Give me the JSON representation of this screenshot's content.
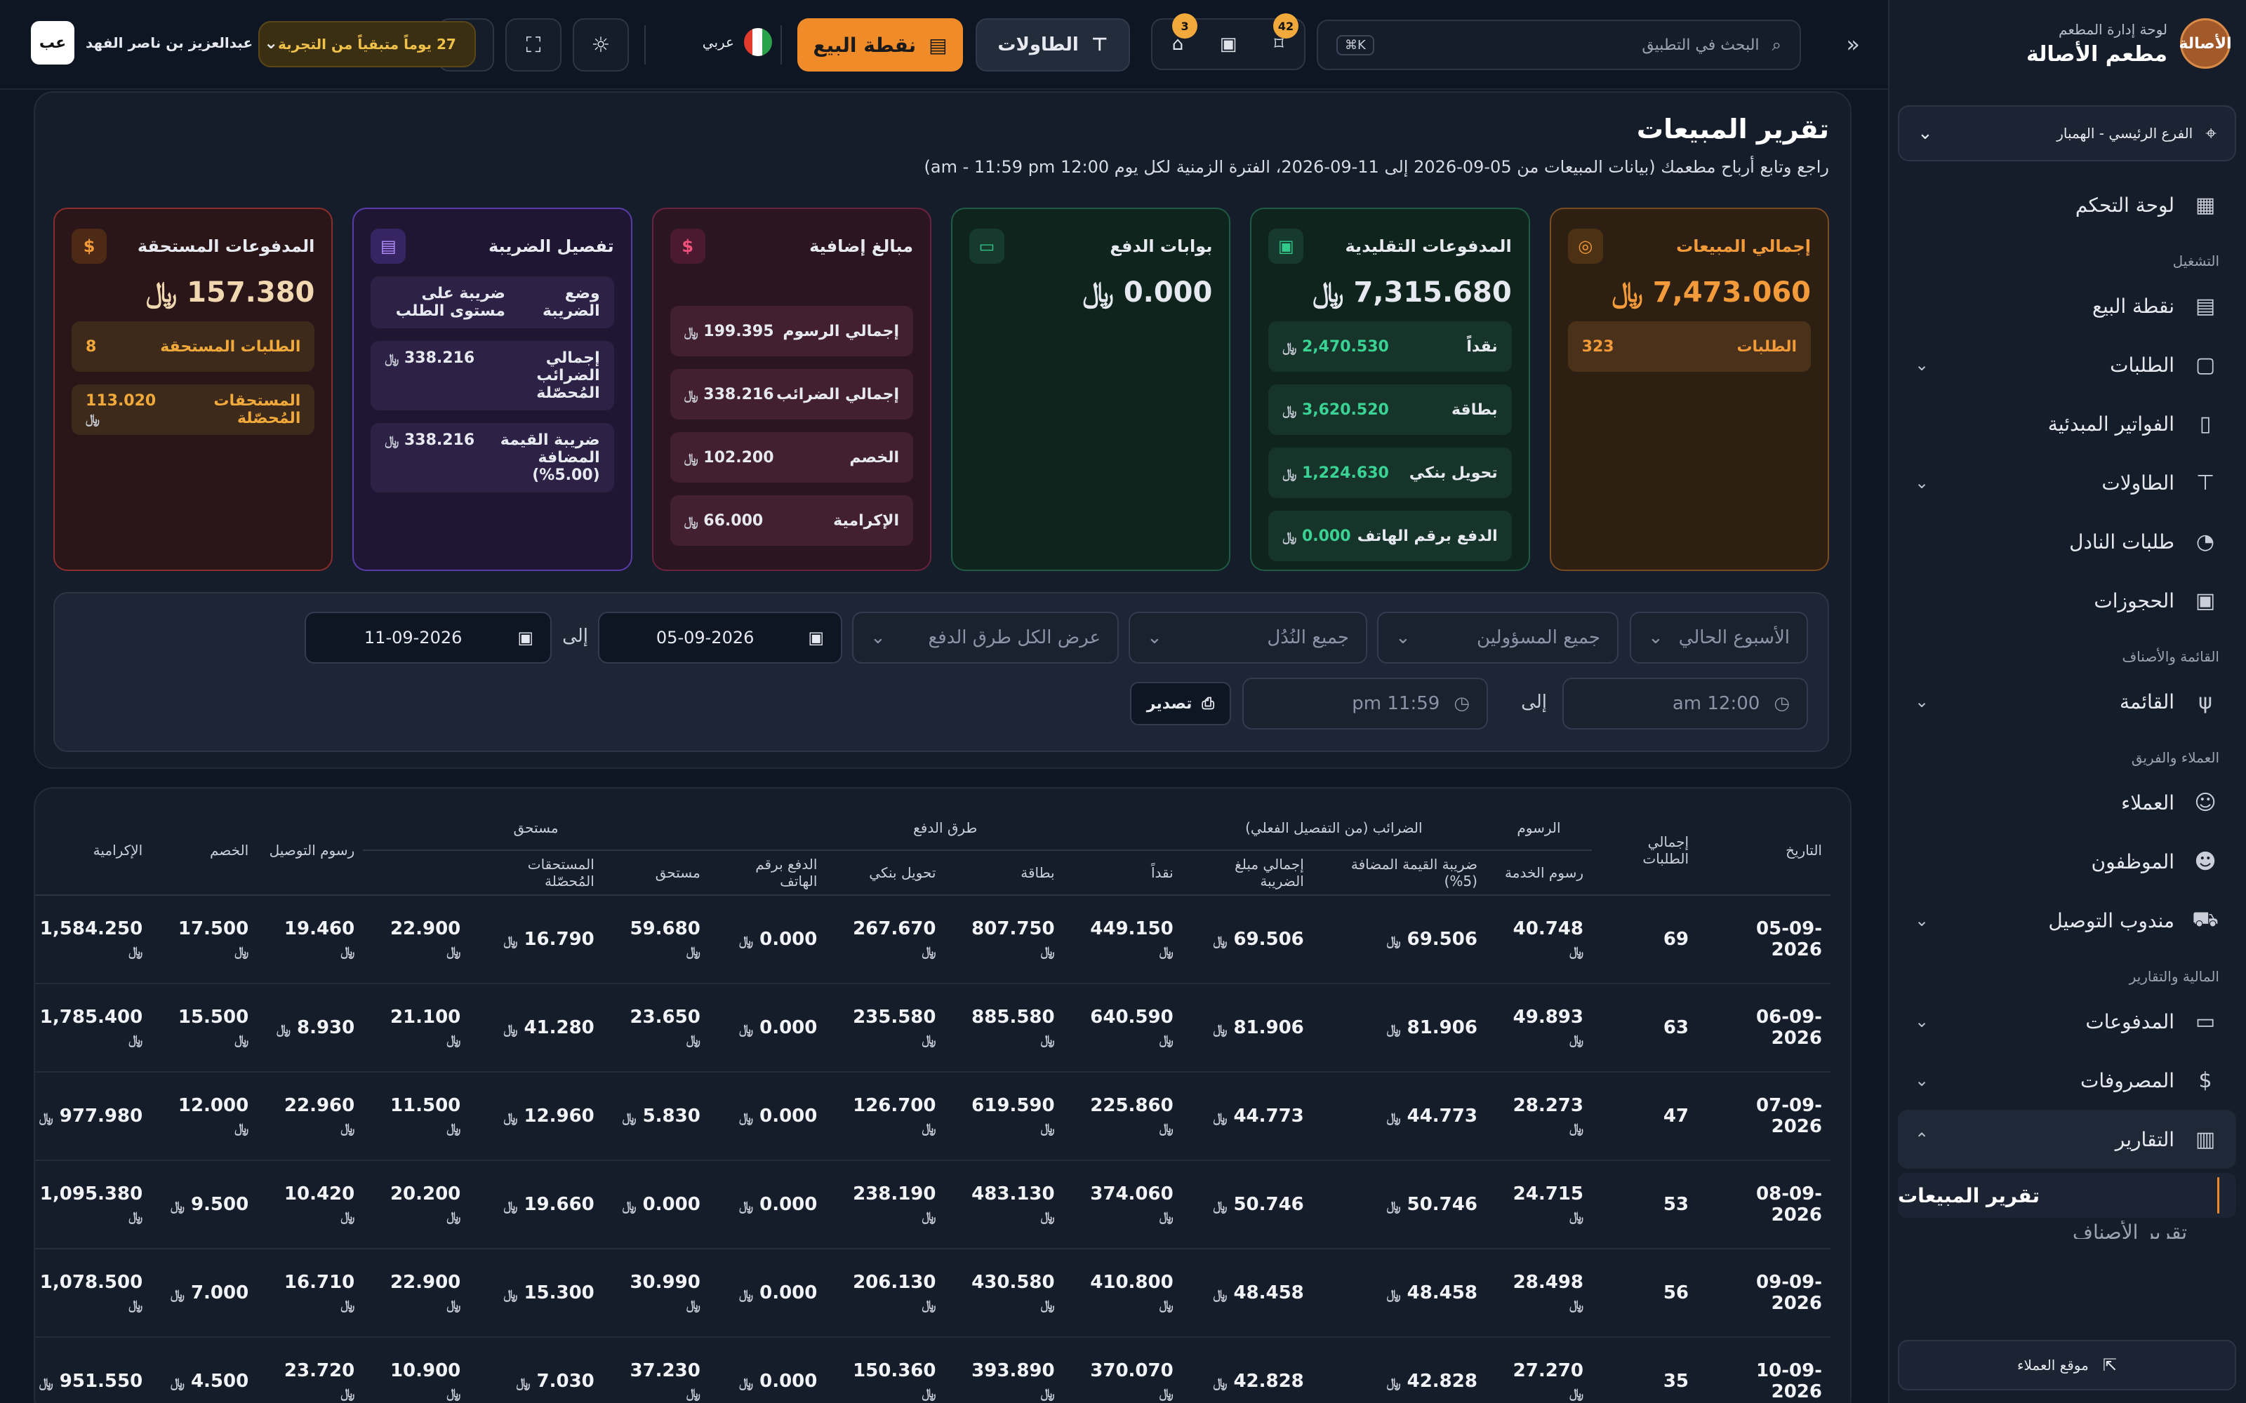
{
  "brand": {
    "logo_text": "الأصالة",
    "subtitle": "لوحة إدارة المطعم",
    "name": "مطعم الأصالة"
  },
  "branch": {
    "label": "الفرع الرئيسي - الهمبار"
  },
  "nav": {
    "dashboard": "لوحة التحكم",
    "sec_operation": "التشغيل",
    "pos": "نقطة البيع",
    "orders": "الطلبات",
    "alt_invoices": "الفواتير المبدئية",
    "tables": "الطاولات",
    "waiter_requests": "طلبات النادل",
    "reservations": "الحجوزات",
    "sec_menu": "القائمة والأصناف",
    "menu": "القائمة",
    "sec_customers": "العملاء والفريق",
    "customers": "العملاء",
    "employees": "الموظفون",
    "delivery": "مندوب التوصيل",
    "sec_finance": "المالية والتقارير",
    "payments": "المدفوعات",
    "expenses": "المصروفات",
    "reports": "التقارير",
    "sales_report": "تقرير المبيعات",
    "items_report": "تقرير الأصناف",
    "customer_site": "موقع العملاء"
  },
  "topbar": {
    "search_placeholder": "البحث في التطبيق",
    "shortcut": "K⌘",
    "badge_bookmarks": "42",
    "badge_calls": "3",
    "tables_btn": "الطاولات",
    "pos_btn": "نقطة البيع",
    "lang": "عربي",
    "trial": "27 يوماً متبقياً من التجربة",
    "avatar": "عب",
    "user_name": "عبدالعزيز بن ناصر الفهد"
  },
  "report": {
    "title": "تقرير المبيعات",
    "description": "راجع وتابع أرباح مطعمك (بيانات المبيعات من 05-09-2026 إلى 11-09-2026، الفترة الزمنية لكل يوم 12:00 am - 11:59 pm)"
  },
  "currency_symbol": "﷼",
  "cards": {
    "sales": {
      "title": "إجمالي المبيعات",
      "value": "7,473.060",
      "rows": [
        {
          "k": "الطلبات",
          "v": "323"
        }
      ]
    },
    "traditional": {
      "title": "المدفوعات التقليدية",
      "value": "7,315.680",
      "rows": [
        {
          "k": "نقداً",
          "v": "2,470.530"
        },
        {
          "k": "بطاقة",
          "v": "3,620.520"
        },
        {
          "k": "تحويل بنكي",
          "v": "1,224.630"
        },
        {
          "k": "الدفع برقم الهاتف",
          "v": "0.000"
        }
      ]
    },
    "gateways": {
      "title": "بوابات الدفع",
      "value": "0.000"
    },
    "extra": {
      "title": "مبالغ إضافية",
      "rows": [
        {
          "k": "إجمالي الرسوم",
          "v": "199.395"
        },
        {
          "k": "إجمالي الضرائب",
          "v": "338.216"
        },
        {
          "k": "الخصم",
          "v": "102.200"
        },
        {
          "k": "الإكرامية",
          "v": "66.000"
        }
      ]
    },
    "tax": {
      "title": "تفصيل الضريبة",
      "rows": [
        {
          "k": "وضع الضريبة",
          "v": "ضريبة على مستوى الطلب"
        },
        {
          "k": "إجمالي الضرائب المُحصّلة",
          "v": "338.216"
        },
        {
          "k": "ضريبة القيمة المضافة (5.00%)",
          "v": "338.216"
        }
      ]
    },
    "due": {
      "title": "المدفوعات المستحقة",
      "value": "157.380",
      "rows": [
        {
          "k": "الطلبات المستحقة",
          "v": "8"
        },
        {
          "k": "المستحقات المُحصّلة",
          "v": "113.020"
        }
      ]
    }
  },
  "filters": {
    "period": "الأسبوع الحالي",
    "managers": "جميع المسؤولين",
    "waiters": "جميع النُدُل",
    "payment_methods": "عرض الكل طرق الدفع",
    "date_from": "05-09-2026",
    "to": "إلى",
    "date_to": "11-09-2026",
    "time_from": "12:00 am",
    "time_to": "11:59 pm",
    "export": "تصدير"
  },
  "table": {
    "groups": {
      "fees": "الرسوم",
      "taxes": "الضرائب (من التفصيل الفعلي)",
      "payment": "طرق الدفع",
      "due": "مستحق"
    },
    "headers": [
      "التاريخ",
      "إجمالي الطلبات",
      "رسوم الخدمة",
      "ضريبة القيمة المضافة (5%)",
      "إجمالي مبلغ الضريبة",
      "نقداً",
      "بطاقة",
      "تحويل بنكي",
      "الدفع برقم الهاتف",
      "مستحق",
      "المستحقات المُحصّلة",
      "",
      "رسوم التوصيل",
      "الخصم",
      "الإكرامية"
    ],
    "rows": [
      [
        "05-09-2026",
        "69",
        "40.748",
        "69.506",
        "69.506",
        "449.150",
        "807.750",
        "267.670",
        "0.000",
        "59.680",
        "16.790",
        "22.900",
        "19.460",
        "17.500",
        "1,584.250"
      ],
      [
        "06-09-2026",
        "63",
        "49.893",
        "81.906",
        "81.906",
        "640.590",
        "885.580",
        "235.580",
        "0.000",
        "23.650",
        "41.280",
        "21.100",
        "8.930",
        "15.500",
        "1,785.400"
      ],
      [
        "07-09-2026",
        "47",
        "28.273",
        "44.773",
        "44.773",
        "225.860",
        "619.590",
        "126.700",
        "0.000",
        "5.830",
        "12.960",
        "11.500",
        "22.960",
        "12.000",
        "977.980"
      ],
      [
        "08-09-2026",
        "53",
        "24.715",
        "50.746",
        "50.746",
        "374.060",
        "483.130",
        "238.190",
        "0.000",
        "0.000",
        "19.660",
        "20.200",
        "10.420",
        "9.500",
        "1,095.380"
      ],
      [
        "09-09-2026",
        "56",
        "28.498",
        "48.458",
        "48.458",
        "410.800",
        "430.580",
        "206.130",
        "0.000",
        "30.990",
        "15.300",
        "22.900",
        "16.710",
        "7.000",
        "1,078.500"
      ],
      [
        "10-09-2026",
        "35",
        "27.270",
        "42.828",
        "42.828",
        "370.070",
        "393.890",
        "150.360",
        "0.000",
        "37.230",
        "7.030",
        "10.900",
        "23.720",
        "4.500",
        "951.550"
      ]
    ]
  }
}
